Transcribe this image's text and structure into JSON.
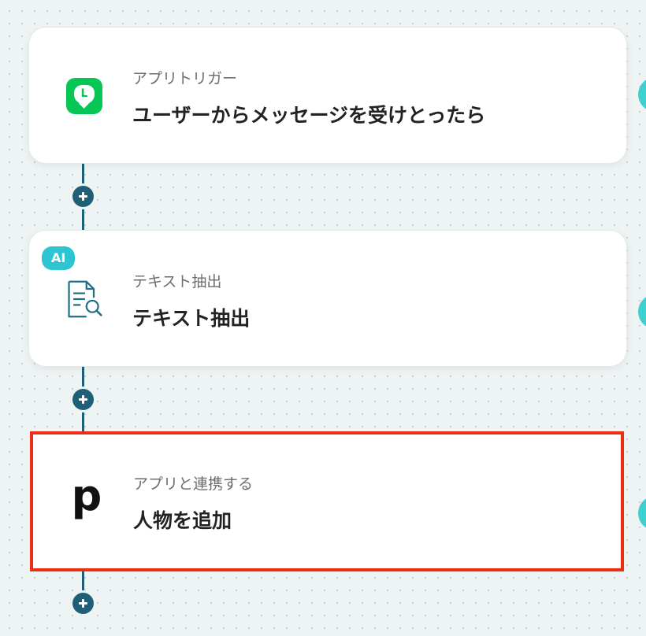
{
  "flow": {
    "steps": [
      {
        "type_label": "アプリトリガー",
        "title": "ユーザーからメッセージを受けとったら",
        "icon": "line-app-icon",
        "icon_text": "L",
        "icon_color": "#06c755"
      },
      {
        "type_label": "テキスト抽出",
        "title": "テキスト抽出",
        "icon": "document-search-icon",
        "badge": "AI",
        "badge_color": "#2ec5d3"
      },
      {
        "type_label": "アプリと連携する",
        "title": "人物を追加",
        "icon": "pipedrive-p-icon",
        "icon_text": "p",
        "selected": true,
        "highlight_color": "#ec2e17"
      }
    ],
    "connector_color": "#1f5f78",
    "side_accent_color": "#3ecfcf"
  }
}
